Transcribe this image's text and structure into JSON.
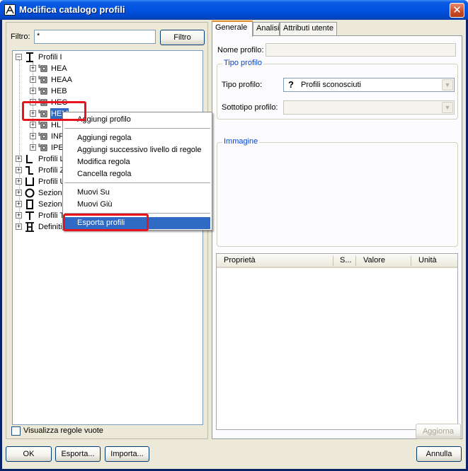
{
  "window": {
    "title": "Modifica catalogo profili",
    "close_glyph": "✕"
  },
  "filter": {
    "label": "Filtro:",
    "value": "*",
    "button": "Filtro"
  },
  "tree": {
    "root": "Profili I",
    "children": [
      "HEA",
      "HEAA",
      "HEB",
      "HEC",
      "HEM",
      "HL",
      "INP",
      "IPE"
    ],
    "top_level": [
      "Profili L",
      "Profili Z",
      "Profili U",
      "Sezioni",
      "Sezioni",
      "Profili T",
      "Definiti"
    ]
  },
  "show_empty_rules": {
    "label": "Visualizza regole vuote",
    "checked": false
  },
  "tabs": [
    "Generale",
    "Analisi",
    "Attributi utente"
  ],
  "general": {
    "profile_name_label": "Nome profilo:",
    "profile_name_value": "",
    "profile_type_group": "Tipo profilo",
    "profile_type_label": "Tipo profilo:",
    "profile_type_value": "Profili sconosciuti",
    "profile_subtype_label": "Sottotipo profilo:",
    "profile_subtype_value": "",
    "image_group": "Immagine"
  },
  "properties_grid": {
    "columns": [
      "Proprietà",
      "S...",
      "Valore",
      "Unità"
    ]
  },
  "buttons": {
    "update": "Aggiorna",
    "ok": "OK",
    "export": "Esporta...",
    "import": "Importa...",
    "cancel": "Annulla"
  },
  "context_menu": {
    "items": [
      "Aggiungi profilo",
      "Aggiungi regola",
      "Aggiungi successivo livello di regole",
      "Modifica regola",
      "Cancella regola",
      "Muovi Su",
      "Muovi Giù",
      "Esporta profili"
    ]
  },
  "colors": {
    "highlight": "#316ac5",
    "annotation_red": "#e8141d",
    "title_blue": "#0054e3"
  }
}
